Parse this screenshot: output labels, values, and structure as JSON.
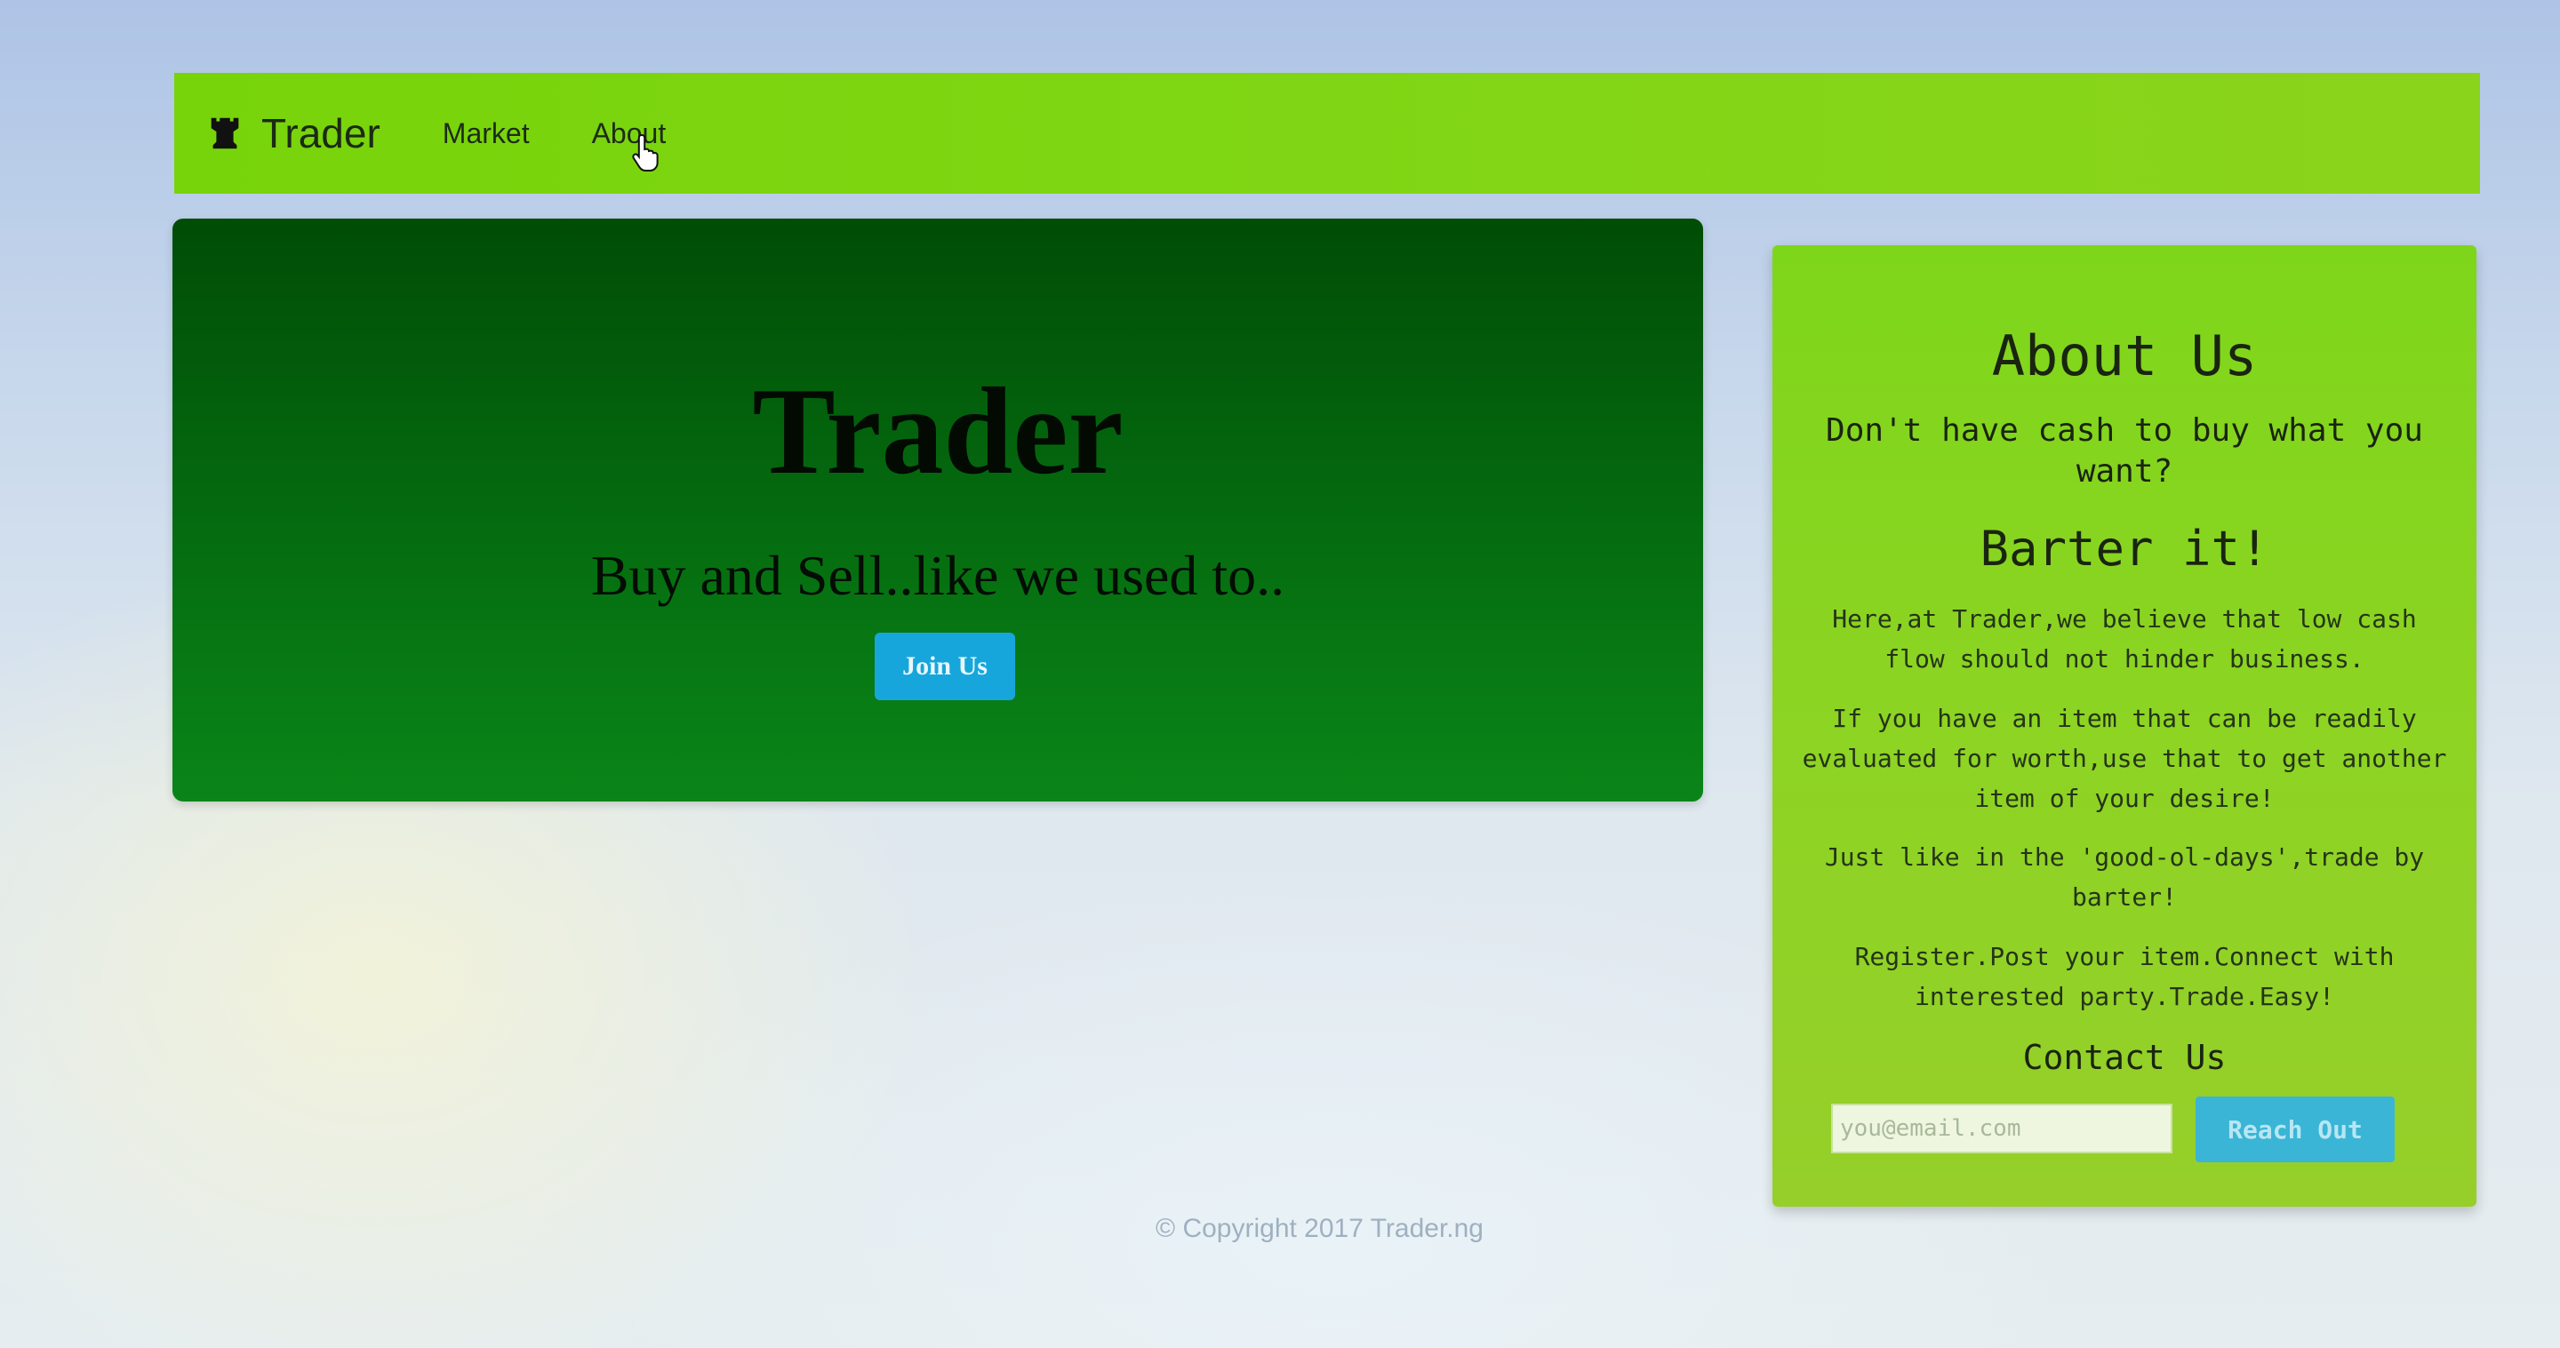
{
  "navbar": {
    "brand_icon": "chess-rook-icon",
    "brand": "Trader",
    "links": [
      "Market",
      "About"
    ]
  },
  "hero": {
    "title": "Trader",
    "subtitle": "Buy and Sell..like we used to..",
    "button_label": "Join Us"
  },
  "about": {
    "heading": "About Us",
    "tagline": "Don't have cash to buy what you want?",
    "subheading": "Barter it!",
    "paragraphs": [
      "Here,at Trader,we believe that low cash flow should not hinder business.",
      "If you have an item that can be readily evaluated for worth,use that to get another item of your desire!",
      "Just like in the 'good-ol-days',trade by barter!",
      "Register.Post your item.Connect with interested party.Trade.Easy!"
    ],
    "contact_heading": "Contact Us",
    "email_placeholder": "you@email.com",
    "reach_button": "Reach Out"
  },
  "footer": {
    "copyright": "© Copyright 2017 Trader.ng"
  },
  "colors": {
    "navbar": "#7ed612",
    "hero": "#056d10",
    "panel": "#8dd423",
    "button": "#16a6dc"
  }
}
